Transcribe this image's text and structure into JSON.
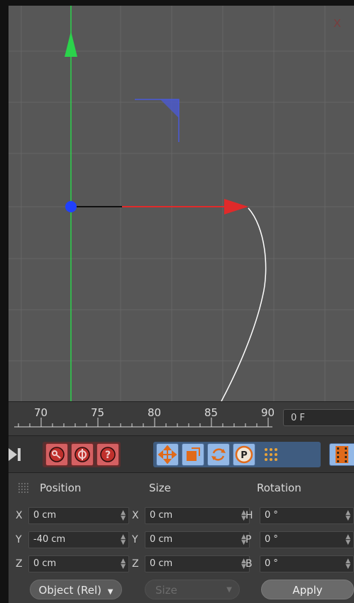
{
  "viewport": {
    "close_glyph": "X"
  },
  "timeline": {
    "ticks": [
      "70",
      "75",
      "80",
      "85",
      "90"
    ],
    "frame_value": "0 F"
  },
  "toolbar": {
    "icons": [
      "go-to-end-icon",
      "record-keys-icon",
      "autokey-icon",
      "help-icon",
      "move-icon",
      "scale-icon",
      "rotate-icon",
      "param-icon",
      "dots-icon",
      "film-icon"
    ]
  },
  "panel": {
    "headers": {
      "position": "Position",
      "size": "Size",
      "rotation": "Rotation"
    },
    "rows": [
      {
        "pos_label": "X",
        "pos_value": "0 cm",
        "size_label": "X",
        "size_value": "0 cm",
        "rot_label": "H",
        "rot_value": "0 °"
      },
      {
        "pos_label": "Y",
        "pos_value": "-40 cm",
        "size_label": "Y",
        "size_value": "0 cm",
        "rot_label": "P",
        "rot_value": "0 °"
      },
      {
        "pos_label": "Z",
        "pos_value": "0 cm",
        "size_label": "Z",
        "size_value": "0 cm",
        "rot_label": "B",
        "rot_value": "0 °"
      }
    ],
    "mode_select": "Object (Rel)",
    "size_select": "Size",
    "apply_label": "Apply"
  },
  "colors": {
    "y_axis": "#2bd34b",
    "x_axis": "#e02a2a",
    "origin": "#2040ff",
    "gizmo": "#4a5ad8",
    "spline": "#ffffff"
  }
}
